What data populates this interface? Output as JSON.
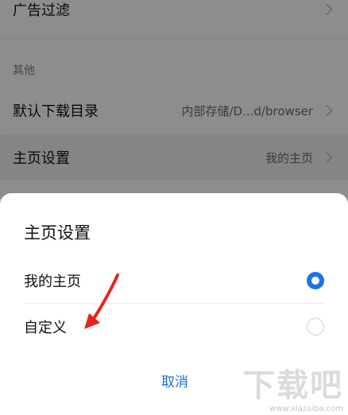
{
  "settings": {
    "ad_filter_label": "广告过滤",
    "section_other": "其他",
    "download_dir_label": "默认下载目录",
    "download_dir_value": "内部存储/D...d/browser",
    "homepage_label": "主页设置",
    "homepage_value": "我的主页"
  },
  "dialog": {
    "title": "主页设置",
    "options": [
      {
        "label": "我的主页",
        "selected": true
      },
      {
        "label": "自定义",
        "selected": false
      }
    ],
    "cancel_label": "取消"
  },
  "colors": {
    "accent": "#1a73e8",
    "annotation": "#e8231c"
  },
  "watermark": {
    "text": "下载吧",
    "url": "www.xiazaiba.com"
  }
}
